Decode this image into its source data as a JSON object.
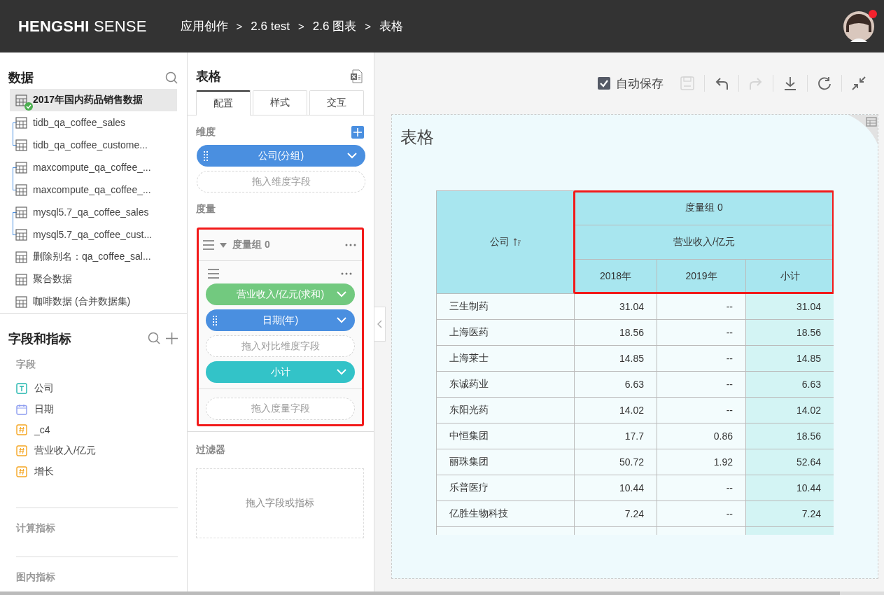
{
  "header": {
    "logo": "**HENGSHI** SENSE",
    "breadcrumbs": [
      {
        "label": "应用创作"
      },
      {
        "label": "2.6 test"
      },
      {
        "label": "2.6 图表"
      },
      {
        "label": "表格"
      }
    ],
    "separator": ">",
    "notification": true
  },
  "data_panel": {
    "title": "数据",
    "items": [
      {
        "label": "2017年国内药品销售数据",
        "selected": true,
        "synced": true,
        "linked_below": false
      },
      {
        "label": "tidb_qa_coffee_sales",
        "selected": false,
        "synced": false,
        "linked_below": true
      },
      {
        "label": "tidb_qa_coffee_custome...",
        "selected": false,
        "synced": false,
        "linked_below": false
      },
      {
        "label": "maxcompute_qa_coffee_...",
        "selected": false,
        "synced": false,
        "linked_below": true
      },
      {
        "label": "maxcompute_qa_coffee_...",
        "selected": false,
        "synced": false,
        "linked_below": false
      },
      {
        "label": "mysql5.7_qa_coffee_sales",
        "selected": false,
        "synced": false,
        "linked_below": true
      },
      {
        "label": "mysql5.7_qa_coffee_cust...",
        "selected": false,
        "synced": false,
        "linked_below": false
      },
      {
        "label": "删除别名：qa_coffee_sal...",
        "selected": false,
        "synced": false,
        "linked_below": false
      },
      {
        "label": "聚合数据",
        "selected": false,
        "synced": false,
        "linked_below": false
      },
      {
        "label": "咖啡数据 (合并数据集)",
        "selected": false,
        "synced": false,
        "linked_below": false
      }
    ]
  },
  "fields_panel": {
    "title": "字段和指标",
    "section": "字段",
    "fields": [
      {
        "label": "公司",
        "kind": "text"
      },
      {
        "label": "日期",
        "kind": "date"
      },
      {
        "label": "_c4",
        "kind": "number"
      },
      {
        "label": "营业收入/亿元",
        "kind": "number"
      },
      {
        "label": "增长",
        "kind": "number"
      }
    ],
    "more_sections": [
      "计算指标",
      "图内指标"
    ]
  },
  "config_panel": {
    "title": "表格",
    "tabs": [
      {
        "label": "配置",
        "selected": true
      },
      {
        "label": "样式",
        "selected": false
      },
      {
        "label": "交互",
        "selected": false
      }
    ],
    "dimensions": {
      "label": "维度",
      "pills": [
        {
          "label": "公司(分组)",
          "kind": "dimension"
        },
        {
          "label": "拖入维度字段",
          "kind": "drop"
        }
      ]
    },
    "measures": {
      "label": "度量",
      "group": {
        "title": "度量组 0",
        "highlighted": true,
        "pills": [
          {
            "label": "营业收入/亿元(求和)",
            "kind": "measure"
          },
          {
            "label": "日期(年)",
            "kind": "dimension"
          },
          {
            "label": "拖入对比维度字段",
            "kind": "drop"
          },
          {
            "label": "小计",
            "kind": "subtotal"
          }
        ],
        "drop": "拖入度量字段"
      }
    },
    "filters": {
      "label": "过滤器",
      "drop": "拖入字段或指标"
    }
  },
  "toolbar": {
    "autosave": {
      "label": "自动保存",
      "checked": true
    },
    "tools": [
      {
        "kind": "save",
        "disabled": true
      },
      {
        "kind": "undo",
        "disabled": false
      },
      {
        "kind": "redo",
        "disabled": true
      },
      {
        "kind": "download",
        "disabled": false
      },
      {
        "kind": "refresh",
        "disabled": false
      },
      {
        "kind": "collapse",
        "disabled": false
      }
    ]
  },
  "chart": {
    "title": "表格",
    "table": {
      "row_header": "公司",
      "group": "度量组 0",
      "measure": "营业收入/亿元",
      "header_highlighted": true,
      "columns": [
        {
          "label": "2018年",
          "subtotal": false
        },
        {
          "label": "2019年",
          "subtotal": false
        },
        {
          "label": "小计",
          "subtotal": true
        }
      ],
      "rows": [
        {
          "name": "三生制药",
          "values": [
            "31.04",
            "--",
            "31.04"
          ]
        },
        {
          "name": "上海医药",
          "values": [
            "18.56",
            "--",
            "18.56"
          ]
        },
        {
          "name": "上海莱士",
          "values": [
            "14.85",
            "--",
            "14.85"
          ]
        },
        {
          "name": "东诚药业",
          "values": [
            "6.63",
            "--",
            "6.63"
          ]
        },
        {
          "name": "东阳光药",
          "values": [
            "14.02",
            "--",
            "14.02"
          ]
        },
        {
          "name": "中恒集团",
          "values": [
            "17.7",
            "0.86",
            "18.56"
          ]
        },
        {
          "name": "丽珠集团",
          "values": [
            "50.72",
            "1.92",
            "52.64"
          ]
        },
        {
          "name": "乐普医疗",
          "values": [
            "10.44",
            "--",
            "10.44"
          ]
        },
        {
          "name": "亿胜生物科技",
          "values": [
            "7.24",
            "--",
            "7.24"
          ]
        }
      ]
    }
  }
}
